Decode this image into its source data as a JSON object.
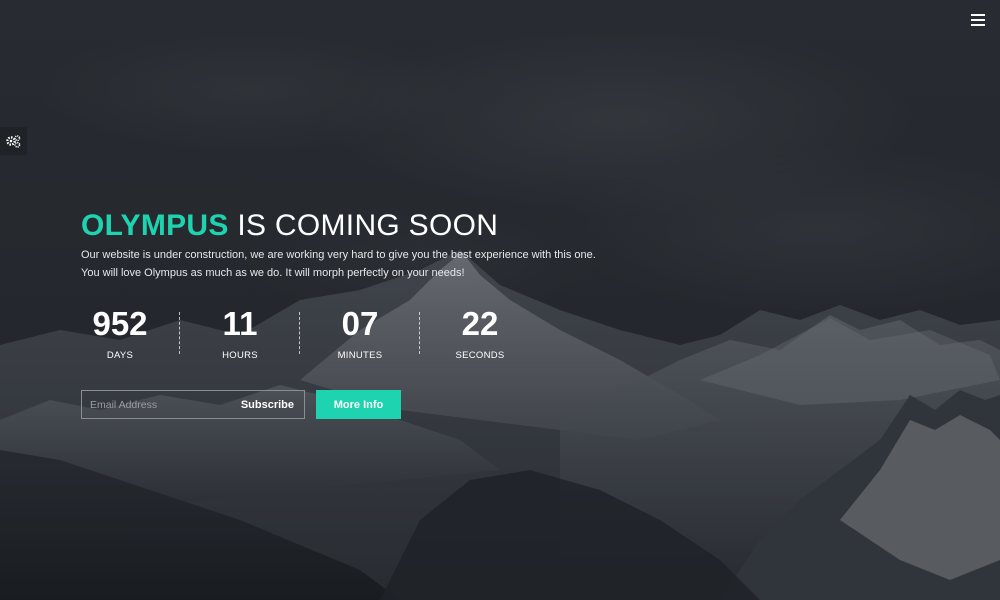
{
  "colors": {
    "accent": "#1ed3b0",
    "text": "#ffffff",
    "background": "#2c3035"
  },
  "hero": {
    "brand": "OLYMPUS",
    "title_rest": " IS COMING SOON",
    "description_line1": "Our website is under construction, we are working very hard to give you the best experience with this one.",
    "description_line2": "You will love Olympus as much as we do. It will morph perfectly on your needs!"
  },
  "countdown": [
    {
      "value": "952",
      "label": "DAYS"
    },
    {
      "value": "11",
      "label": "HOURS"
    },
    {
      "value": "07",
      "label": "MINUTES"
    },
    {
      "value": "22",
      "label": "SECONDS"
    }
  ],
  "form": {
    "email_placeholder": "Email Address",
    "email_value": "",
    "subscribe_label": "Subscribe",
    "more_info_label": "More Info"
  },
  "icons": {
    "menu": "hamburger-menu-icon",
    "settings": "gears-icon"
  }
}
